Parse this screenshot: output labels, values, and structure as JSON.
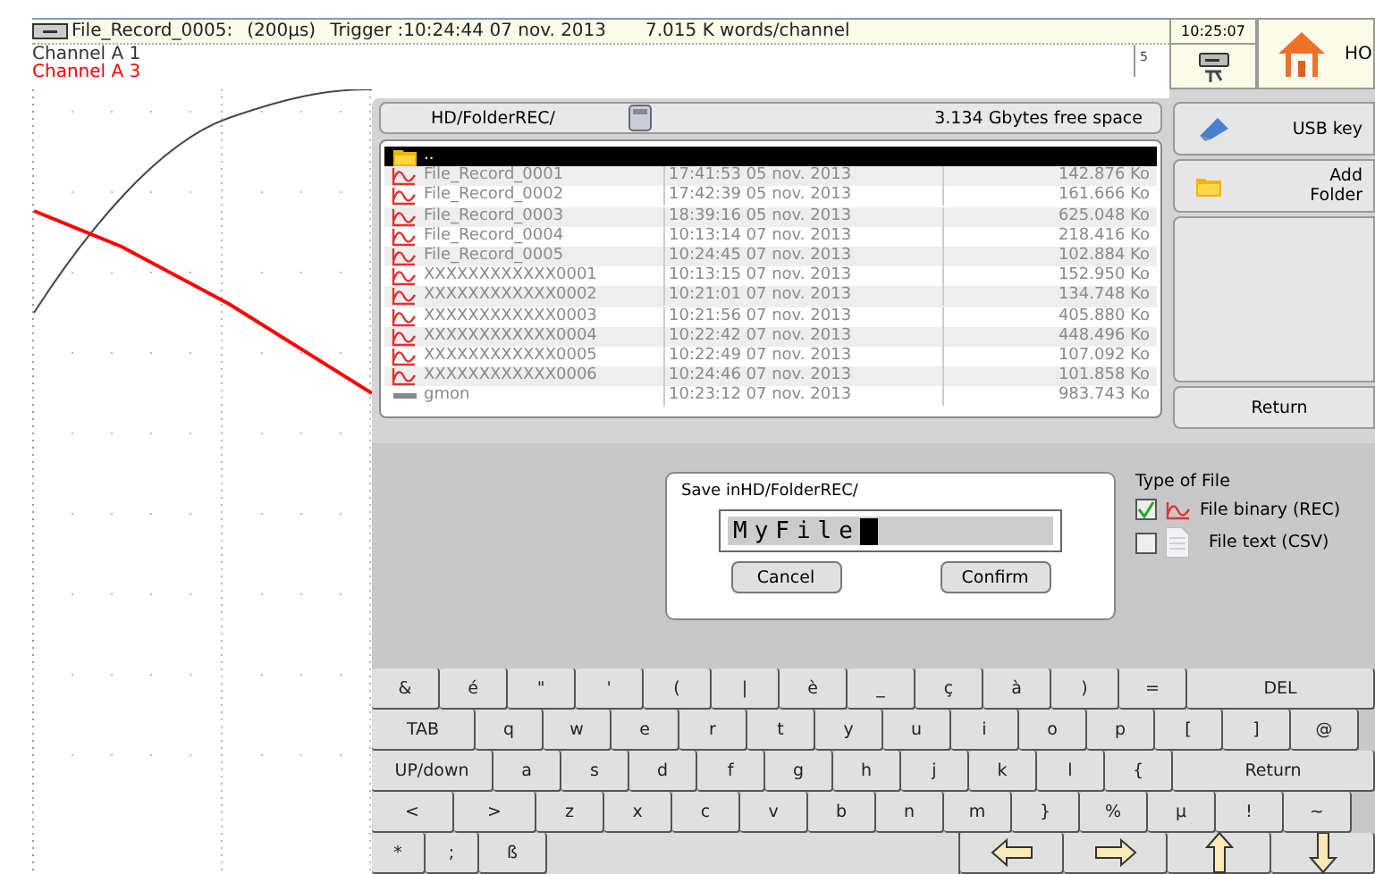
{
  "header": {
    "file": "File_Record_0005:",
    "timebase": "(200µs)",
    "trigger": "Trigger :10:24:44 07 nov. 2013",
    "words": "7.015 K words/channel"
  },
  "clock": "10:25:07",
  "home": {
    "label": "HO"
  },
  "channels": [
    {
      "name": "Channel A 1",
      "color": "#333333"
    },
    {
      "name": "Channel A 3",
      "color": "#ff0000"
    }
  ],
  "scale_mark": "5",
  "browser": {
    "path": "HD/FolderREC/",
    "free_space": "3.134 Gbytes free space",
    "files": [
      {
        "kind": "folder",
        "name": "..",
        "selected": true
      },
      {
        "kind": "record",
        "name": "File_Record_0001",
        "date": "17:41:53 05 nov. 2013",
        "size": "142.876 Ko",
        "selected": false
      },
      {
        "kind": "record",
        "name": "File_Record_0002",
        "date": "17:42:39 05 nov. 2013",
        "size": "161.666 Ko",
        "selected": false
      },
      {
        "kind": "record",
        "name": "File_Record_0003",
        "date": "18:39:16 05 nov. 2013",
        "size": "625.048 Ko",
        "selected": false
      },
      {
        "kind": "record",
        "name": "File_Record_0004",
        "date": "10:13:14 07 nov. 2013",
        "size": "218.416 Ko",
        "selected": false
      },
      {
        "kind": "record",
        "name": "File_Record_0005",
        "date": "10:24:45 07 nov. 2013",
        "size": "102.884 Ko",
        "selected": false
      },
      {
        "kind": "record",
        "name": "XXXXXXXXXXXX0001",
        "date": "10:13:15 07 nov. 2013",
        "size": "152.950 Ko",
        "selected": false
      },
      {
        "kind": "record",
        "name": "XXXXXXXXXXXX0002",
        "date": "10:21:01 07 nov. 2013",
        "size": "134.748 Ko",
        "selected": false
      },
      {
        "kind": "record",
        "name": "XXXXXXXXXXXX0003",
        "date": "10:21:56 07 nov. 2013",
        "size": "405.880 Ko",
        "selected": false
      },
      {
        "kind": "record",
        "name": "XXXXXXXXXXXX0004",
        "date": "10:22:42 07 nov. 2013",
        "size": "448.496 Ko",
        "selected": false
      },
      {
        "kind": "record",
        "name": "XXXXXXXXXXXX0005",
        "date": "10:22:49 07 nov. 2013",
        "size": "107.092 Ko",
        "selected": false
      },
      {
        "kind": "record",
        "name": "XXXXXXXXXXXX0006",
        "date": "10:24:46 07 nov. 2013",
        "size": "101.858 Ko",
        "selected": false
      },
      {
        "kind": "other",
        "name": "gmon",
        "date": "10:23:12 07 nov. 2013",
        "size": "983.743 Ko",
        "selected": false
      }
    ]
  },
  "side_buttons": [
    {
      "kind": "usb",
      "label": "USB key"
    },
    {
      "kind": "folder",
      "label": "Add Folder"
    },
    {
      "kind": "blank"
    },
    {
      "kind": "plain",
      "label": "Return"
    }
  ],
  "save_dialog": {
    "title": "Save inHD/FolderREC/",
    "value": "MyFile",
    "buttons": [
      "Cancel",
      "Confirm"
    ]
  },
  "file_type": {
    "title": "Type of File",
    "options": [
      {
        "kind": "record",
        "label": "File binary (REC)",
        "checked": true
      },
      {
        "kind": "text",
        "label": "File text (CSV)",
        "checked": false
      }
    ]
  },
  "keyboard": [
    [
      {
        "label": "&"
      },
      {
        "label": "é"
      },
      {
        "label": "\""
      },
      {
        "label": "'"
      },
      {
        "label": "("
      },
      {
        "label": "|"
      },
      {
        "label": "è"
      },
      {
        "label": "_"
      },
      {
        "label": "ç"
      },
      {
        "label": "à"
      },
      {
        "label": ")"
      },
      {
        "label": "="
      },
      {
        "label": "DEL",
        "kind": "fill"
      }
    ],
    [
      {
        "label": "TAB",
        "kind": "tab"
      },
      {
        "label": "q"
      },
      {
        "label": "w"
      },
      {
        "label": "e"
      },
      {
        "label": "r"
      },
      {
        "label": "t"
      },
      {
        "label": "y"
      },
      {
        "label": "u"
      },
      {
        "label": "i"
      },
      {
        "label": "o"
      },
      {
        "label": "p"
      },
      {
        "label": "["
      },
      {
        "label": "]"
      },
      {
        "label": "@"
      }
    ],
    [
      {
        "label": "UP/down",
        "kind": "updown"
      },
      {
        "label": "a"
      },
      {
        "label": "s"
      },
      {
        "label": "d"
      },
      {
        "label": "f"
      },
      {
        "label": "g"
      },
      {
        "label": "h"
      },
      {
        "label": "j"
      },
      {
        "label": "k"
      },
      {
        "label": "l"
      },
      {
        "label": "{"
      },
      {
        "label": "Return",
        "kind": "fill"
      }
    ],
    [
      {
        "label": "<",
        "kind": "angle"
      },
      {
        "label": ">",
        "kind": "angle"
      },
      {
        "label": "z"
      },
      {
        "label": "x"
      },
      {
        "label": "c"
      },
      {
        "label": "v"
      },
      {
        "label": "b"
      },
      {
        "label": "n"
      },
      {
        "label": "m"
      },
      {
        "label": "}"
      },
      {
        "label": "%"
      },
      {
        "label": "µ"
      },
      {
        "label": "!"
      },
      {
        "label": "~"
      }
    ],
    [
      {
        "label": "*",
        "kind": "small"
      },
      {
        "label": ";",
        "kind": "small"
      },
      {
        "label": "ß"
      },
      {
        "kind": "space"
      },
      {
        "kind": "left"
      },
      {
        "kind": "right"
      },
      {
        "kind": "up"
      },
      {
        "kind": "down"
      }
    ]
  ]
}
